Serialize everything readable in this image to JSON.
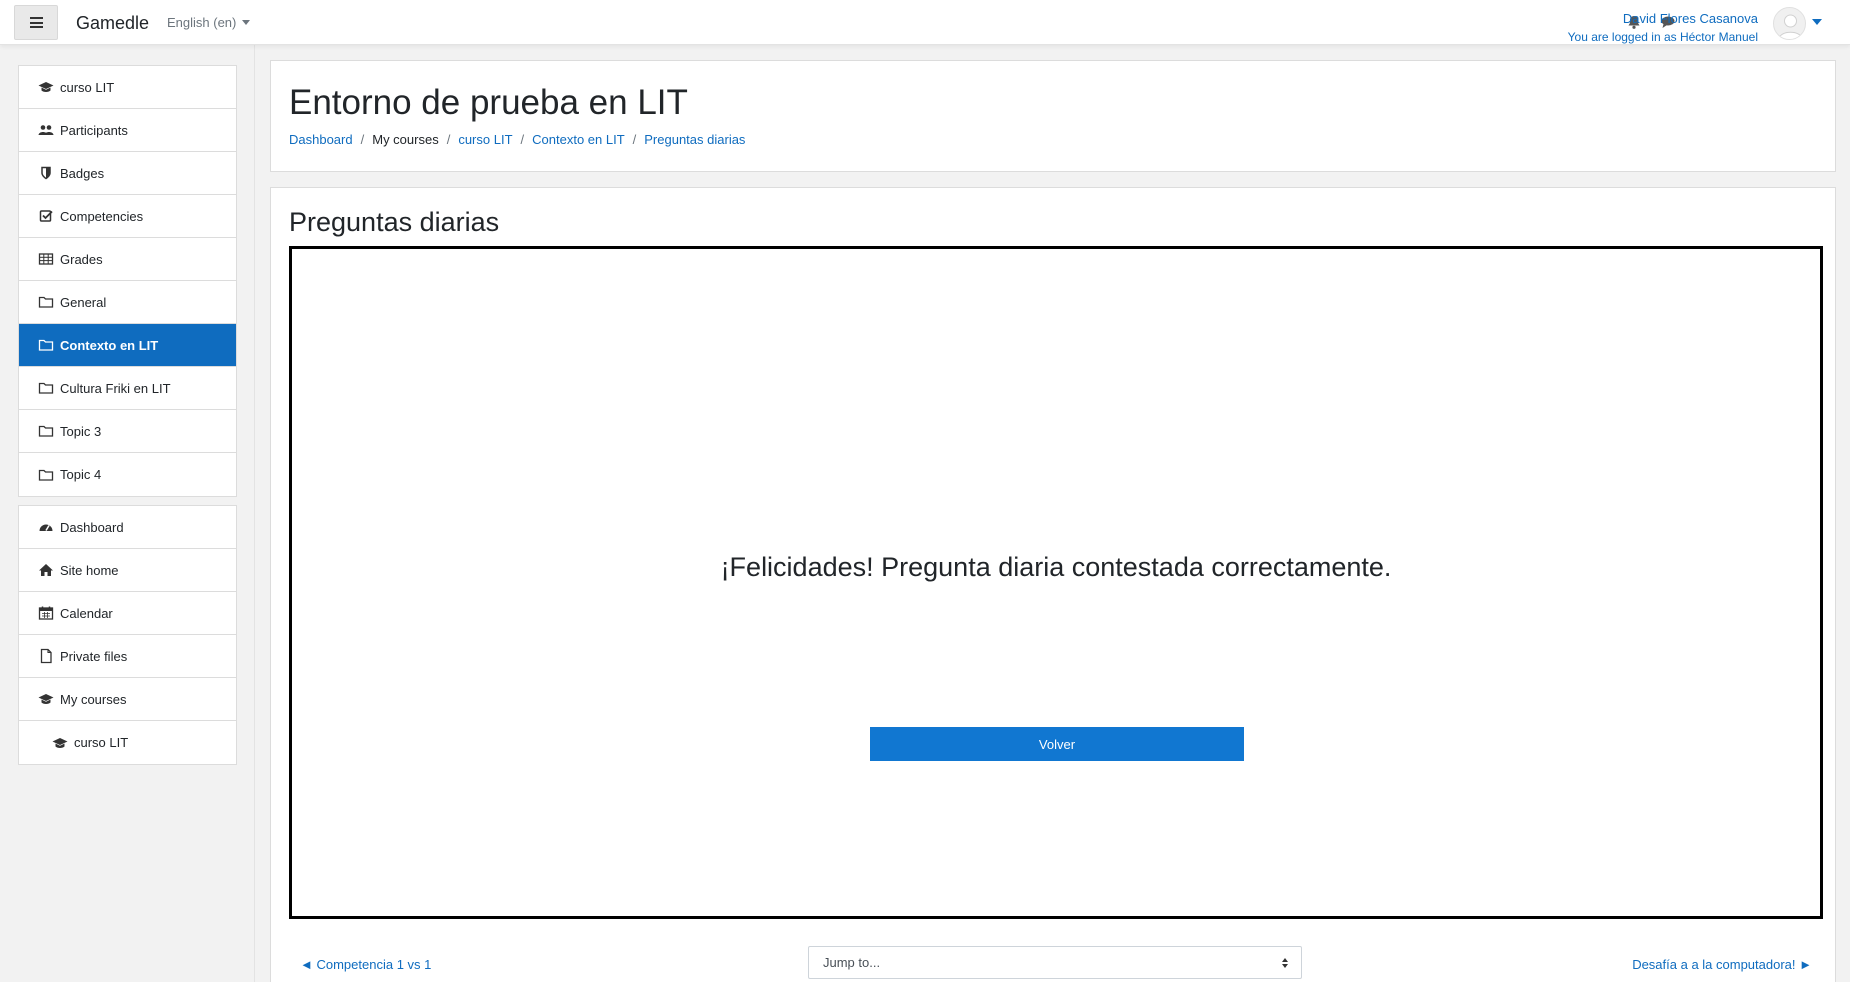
{
  "navbar": {
    "brand": "Gamedle",
    "language": "English (en)",
    "user_name": "David Flores Casanova",
    "logged_in_as": "You are logged in as Héctor Manuel"
  },
  "drawer": {
    "course_items": [
      {
        "label": "curso LIT",
        "icon": "graduation-cap-icon"
      },
      {
        "label": "Participants",
        "icon": "users-icon"
      },
      {
        "label": "Badges",
        "icon": "shield-icon"
      },
      {
        "label": "Competencies",
        "icon": "check-square-icon"
      },
      {
        "label": "Grades",
        "icon": "table-icon"
      },
      {
        "label": "General",
        "icon": "folder-icon"
      },
      {
        "label": "Contexto en LIT",
        "icon": "folder-icon"
      },
      {
        "label": "Cultura Friki en LIT",
        "icon": "folder-icon"
      },
      {
        "label": "Topic 3",
        "icon": "folder-icon"
      },
      {
        "label": "Topic 4",
        "icon": "folder-icon"
      }
    ],
    "site_items": [
      {
        "label": "Dashboard",
        "icon": "dashboard-icon"
      },
      {
        "label": "Site home",
        "icon": "home-icon"
      },
      {
        "label": "Calendar",
        "icon": "calendar-icon"
      },
      {
        "label": "Private files",
        "icon": "file-icon"
      },
      {
        "label": "My courses",
        "icon": "graduation-cap-icon"
      },
      {
        "label": "curso LIT",
        "icon": "graduation-cap-icon"
      }
    ]
  },
  "header": {
    "title": "Entorno de prueba en LIT",
    "breadcrumb": [
      "Dashboard",
      "My courses",
      "curso LIT",
      "Contexto en LIT",
      "Preguntas diarias"
    ]
  },
  "main": {
    "section_title": "Preguntas diarias",
    "message": "¡Felicidades! Pregunta diaria contestada correctamente.",
    "button_label": "Volver"
  },
  "footer_nav": {
    "prev_label": "◄ Competencia 1 vs 1",
    "jump_label": "Jump to...",
    "next_label": "Desafía a a la computadora! ►"
  },
  "colors": {
    "accent": "#0f6cbf",
    "button": "#1177d1"
  }
}
